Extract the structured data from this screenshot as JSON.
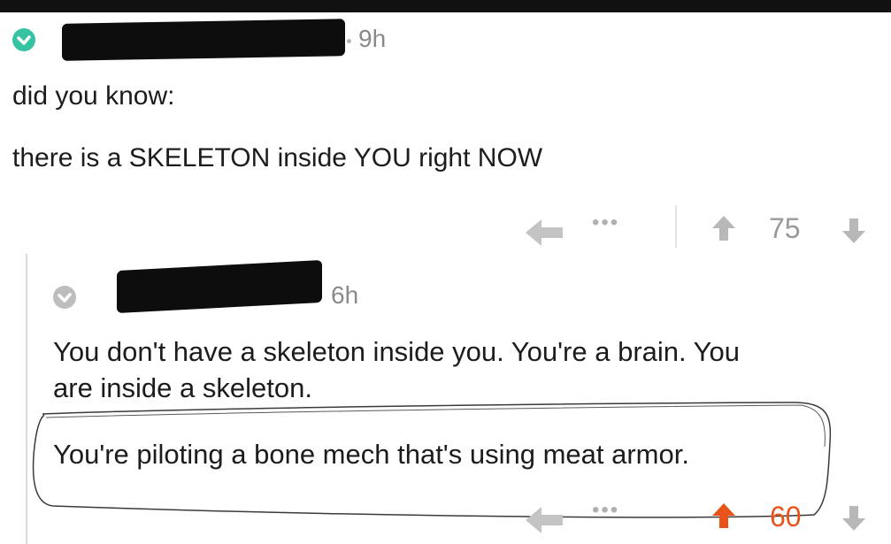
{
  "colors": {
    "verified_badge": "#35c3a3",
    "badge_gray": "#bdbdbd",
    "upvoted": "#e8541a",
    "meta_text": "#8a8a8a"
  },
  "comment": {
    "author": "",
    "time": "9h",
    "text_line1": "did you know:",
    "text_line2": "there is a SKELETON inside YOU right NOW",
    "actions": {
      "reply_icon": "reply-arrow-icon",
      "more_label": "•••",
      "score": "75",
      "upvoted": false
    }
  },
  "reply": {
    "author": "",
    "time": "6h",
    "text_line1": "You don't have a skeleton inside you. You're a brain. You",
    "text_line2": "are inside a skeleton.",
    "text_line3": "You're piloting a bone mech that's using meat armor.",
    "actions": {
      "reply_icon": "reply-arrow-icon",
      "more_label": "•••",
      "score": "60",
      "upvoted": true
    }
  }
}
